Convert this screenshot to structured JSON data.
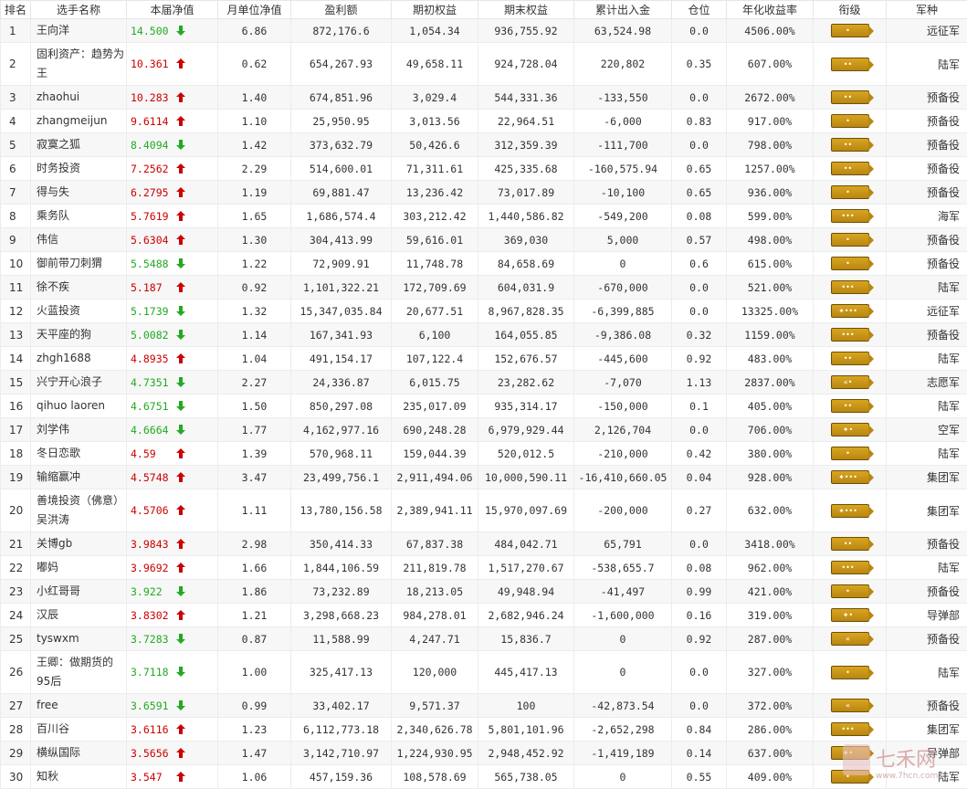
{
  "columns": [
    "排名",
    "选手名称",
    "本届净值",
    "月单位净值",
    "盈利额",
    "期初权益",
    "期末权益",
    "累计出入金",
    "仓位",
    "年化收益率",
    "衔级",
    "军种"
  ],
  "rows": [
    {
      "rank": "1",
      "name": "王向洋",
      "net": "14.500",
      "dir": "down",
      "unit": "6.86",
      "profit": "872,176.6",
      "start": "1,054.34",
      "end": "936,755.92",
      "flow": "63,524.98",
      "pos": "0.0",
      "annual": "4506.00%",
      "badge": "•",
      "army": "远征军"
    },
    {
      "rank": "2",
      "name": "固利资产：趋势为王",
      "net": "10.361",
      "dir": "up",
      "unit": "0.62",
      "profit": "654,267.93",
      "start": "49,658.11",
      "end": "924,728.04",
      "flow": "220,802",
      "pos": "0.35",
      "annual": "607.00%",
      "badge": "••",
      "army": "陆军",
      "tall": true
    },
    {
      "rank": "3",
      "name": "zhaohui",
      "net": "10.283",
      "dir": "up",
      "unit": "1.40",
      "profit": "674,851.96",
      "start": "3,029.4",
      "end": "544,331.36",
      "flow": "-133,550",
      "pos": "0.0",
      "annual": "2672.00%",
      "badge": "••",
      "army": "预备役"
    },
    {
      "rank": "4",
      "name": "zhangmeijun",
      "net": "9.6114",
      "dir": "up",
      "unit": "1.10",
      "profit": "25,950.95",
      "start": "3,013.56",
      "end": "22,964.51",
      "flow": "-6,000",
      "pos": "0.83",
      "annual": "917.00%",
      "badge": "•",
      "army": "预备役"
    },
    {
      "rank": "5",
      "name": "寂寞之狐",
      "net": "8.4094",
      "dir": "down",
      "unit": "1.42",
      "profit": "373,632.79",
      "start": "50,426.6",
      "end": "312,359.39",
      "flow": "-111,700",
      "pos": "0.0",
      "annual": "798.00%",
      "badge": "••",
      "army": "预备役"
    },
    {
      "rank": "6",
      "name": "时务投资",
      "net": "7.2562",
      "dir": "up",
      "unit": "2.29",
      "profit": "514,600.01",
      "start": "71,311.61",
      "end": "425,335.68",
      "flow": "-160,575.94",
      "pos": "0.65",
      "annual": "1257.00%",
      "badge": "••",
      "army": "预备役"
    },
    {
      "rank": "7",
      "name": "得与失",
      "net": "6.2795",
      "dir": "up",
      "unit": "1.19",
      "profit": "69,881.47",
      "start": "13,236.42",
      "end": "73,017.89",
      "flow": "-10,100",
      "pos": "0.65",
      "annual": "936.00%",
      "badge": "•",
      "army": "预备役"
    },
    {
      "rank": "8",
      "name": "乘务队",
      "net": "5.7619",
      "dir": "up",
      "unit": "1.65",
      "profit": "1,686,574.4",
      "start": "303,212.42",
      "end": "1,440,586.82",
      "flow": "-549,200",
      "pos": "0.08",
      "annual": "599.00%",
      "badge": "•••",
      "army": "海军"
    },
    {
      "rank": "9",
      "name": "伟信",
      "net": "5.6304",
      "dir": "up",
      "unit": "1.30",
      "profit": "304,413.99",
      "start": "59,616.01",
      "end": "369,030",
      "flow": "5,000",
      "pos": "0.57",
      "annual": "498.00%",
      "badge": "•",
      "army": "预备役"
    },
    {
      "rank": "10",
      "name": "御前带刀刺猬",
      "net": "5.5488",
      "dir": "down",
      "unit": "1.22",
      "profit": "72,909.91",
      "start": "11,748.78",
      "end": "84,658.69",
      "flow": "0",
      "pos": "0.6",
      "annual": "615.00%",
      "badge": "•",
      "army": "预备役"
    },
    {
      "rank": "11",
      "name": "徐不疾",
      "net": "5.187",
      "dir": "up",
      "unit": "0.92",
      "profit": "1,101,322.21",
      "start": "172,709.69",
      "end": "604,031.9",
      "flow": "-670,000",
      "pos": "0.0",
      "annual": "521.00%",
      "badge": "•••",
      "army": "陆军"
    },
    {
      "rank": "12",
      "name": "火蓝投资",
      "net": "5.1739",
      "dir": "down",
      "unit": "1.32",
      "profit": "15,347,035.84",
      "start": "20,677.51",
      "end": "8,967,828.35",
      "flow": "-6,399,885",
      "pos": "0.0",
      "annual": "13325.00%",
      "badge": "✦•••",
      "army": "远征军"
    },
    {
      "rank": "13",
      "name": "天平座的狗",
      "net": "5.0082",
      "dir": "down",
      "unit": "1.14",
      "profit": "167,341.93",
      "start": "6,100",
      "end": "164,055.85",
      "flow": "-9,386.08",
      "pos": "0.32",
      "annual": "1159.00%",
      "badge": "•••",
      "army": "预备役"
    },
    {
      "rank": "14",
      "name": "zhgh1688",
      "net": "4.8935",
      "dir": "up",
      "unit": "1.04",
      "profit": "491,154.17",
      "start": "107,122.4",
      "end": "152,676.57",
      "flow": "-445,600",
      "pos": "0.92",
      "annual": "483.00%",
      "badge": "••",
      "army": "陆军"
    },
    {
      "rank": "15",
      "name": "兴宁开心浪子",
      "net": "4.7351",
      "dir": "down",
      "unit": "2.27",
      "profit": "24,336.87",
      "start": "6,015.75",
      "end": "23,282.62",
      "flow": "-7,070",
      "pos": "1.13",
      "annual": "2837.00%",
      "badge": "«•",
      "army": "志愿军"
    },
    {
      "rank": "16",
      "name": "qihuo laoren",
      "net": "4.6751",
      "dir": "down",
      "unit": "1.50",
      "profit": "850,297.08",
      "start": "235,017.09",
      "end": "935,314.17",
      "flow": "-150,000",
      "pos": "0.1",
      "annual": "405.00%",
      "badge": "••",
      "army": "陆军"
    },
    {
      "rank": "17",
      "name": "刘学伟",
      "net": "4.6664",
      "dir": "down",
      "unit": "1.77",
      "profit": "4,162,977.16",
      "start": "690,248.28",
      "end": "6,979,929.44",
      "flow": "2,126,704",
      "pos": "0.0",
      "annual": "706.00%",
      "badge": "✦•",
      "army": "空军"
    },
    {
      "rank": "18",
      "name": "冬日恋歌",
      "net": "4.59",
      "dir": "up",
      "unit": "1.39",
      "profit": "570,968.11",
      "start": "159,044.39",
      "end": "520,012.5",
      "flow": "-210,000",
      "pos": "0.42",
      "annual": "380.00%",
      "badge": "•",
      "army": "陆军"
    },
    {
      "rank": "19",
      "name": "输缩赢冲",
      "net": "4.5748",
      "dir": "up",
      "unit": "3.47",
      "profit": "23,499,756.1",
      "start": "2,911,494.06",
      "end": "10,000,590.11",
      "flow": "-16,410,660.05",
      "pos": "0.04",
      "annual": "928.00%",
      "badge": "✦•••",
      "army": "集团军"
    },
    {
      "rank": "20",
      "name": "善境投资（佛意）吴洪涛",
      "net": "4.5706",
      "dir": "up",
      "unit": "1.11",
      "profit": "13,780,156.58",
      "start": "2,389,941.11",
      "end": "15,970,097.69",
      "flow": "-200,000",
      "pos": "0.27",
      "annual": "632.00%",
      "badge": "✦•••",
      "army": "集团军",
      "tall": true
    },
    {
      "rank": "21",
      "name": "关博gb",
      "net": "3.9843",
      "dir": "up",
      "unit": "2.98",
      "profit": "350,414.33",
      "start": "67,837.38",
      "end": "484,042.71",
      "flow": "65,791",
      "pos": "0.0",
      "annual": "3418.00%",
      "badge": "••",
      "army": "预备役"
    },
    {
      "rank": "22",
      "name": "嘟妈",
      "net": "3.9692",
      "dir": "up",
      "unit": "1.66",
      "profit": "1,844,106.59",
      "start": "211,819.78",
      "end": "1,517,270.67",
      "flow": "-538,655.7",
      "pos": "0.08",
      "annual": "962.00%",
      "badge": "•••",
      "army": "陆军"
    },
    {
      "rank": "23",
      "name": "小红哥哥",
      "net": "3.922",
      "dir": "down",
      "unit": "1.86",
      "profit": "73,232.89",
      "start": "18,213.05",
      "end": "49,948.94",
      "flow": "-41,497",
      "pos": "0.99",
      "annual": "421.00%",
      "badge": "•",
      "army": "预备役"
    },
    {
      "rank": "24",
      "name": "汉辰",
      "net": "3.8302",
      "dir": "up",
      "unit": "1.21",
      "profit": "3,298,668.23",
      "start": "984,278.01",
      "end": "2,682,946.24",
      "flow": "-1,600,000",
      "pos": "0.16",
      "annual": "319.00%",
      "badge": "✦•",
      "army": "导弹部"
    },
    {
      "rank": "25",
      "name": "tyswxm",
      "net": "3.7283",
      "dir": "down",
      "unit": "0.87",
      "profit": "11,588.99",
      "start": "4,247.71",
      "end": "15,836.7",
      "flow": "0",
      "pos": "0.92",
      "annual": "287.00%",
      "badge": "«",
      "army": "预备役"
    },
    {
      "rank": "26",
      "name": "王卿：做期货的95后",
      "net": "3.7118",
      "dir": "down",
      "unit": "1.00",
      "profit": "325,417.13",
      "start": "120,000",
      "end": "445,417.13",
      "flow": "0",
      "pos": "0.0",
      "annual": "327.00%",
      "badge": "•",
      "army": "陆军",
      "tall": true
    },
    {
      "rank": "27",
      "name": "free",
      "net": "3.6591",
      "dir": "down",
      "unit": "0.99",
      "profit": "33,402.17",
      "start": "9,571.37",
      "end": "100",
      "flow": "-42,873.54",
      "pos": "0.0",
      "annual": "372.00%",
      "badge": "«",
      "army": "预备役"
    },
    {
      "rank": "28",
      "name": "百川谷",
      "net": "3.6116",
      "dir": "up",
      "unit": "1.23",
      "profit": "6,112,773.18",
      "start": "2,340,626.78",
      "end": "5,801,101.96",
      "flow": "-2,652,298",
      "pos": "0.84",
      "annual": "286.00%",
      "badge": "•••",
      "army": "集团军"
    },
    {
      "rank": "29",
      "name": "横纵国际",
      "net": "3.5656",
      "dir": "up",
      "unit": "1.47",
      "profit": "3,142,710.97",
      "start": "1,224,930.95",
      "end": "2,948,452.92",
      "flow": "-1,419,189",
      "pos": "0.14",
      "annual": "637.00%",
      "badge": "✦•",
      "army": "导弹部"
    },
    {
      "rank": "30",
      "name": "知秋",
      "net": "3.547",
      "dir": "up",
      "unit": "1.06",
      "profit": "457,159.36",
      "start": "108,578.69",
      "end": "565,738.05",
      "flow": "0",
      "pos": "0.55",
      "annual": "409.00%",
      "badge": "•",
      "army": "陆军"
    }
  ],
  "colors": {
    "up": "#cc0000",
    "down": "#22aa22",
    "badge": "#c9961a"
  },
  "icons": {
    "up": "arrow-up-icon",
    "down": "arrow-down-icon",
    "badge": "rank-badge-icon"
  },
  "watermark": {
    "text": "七禾网",
    "url": "www.7hcn.com"
  }
}
